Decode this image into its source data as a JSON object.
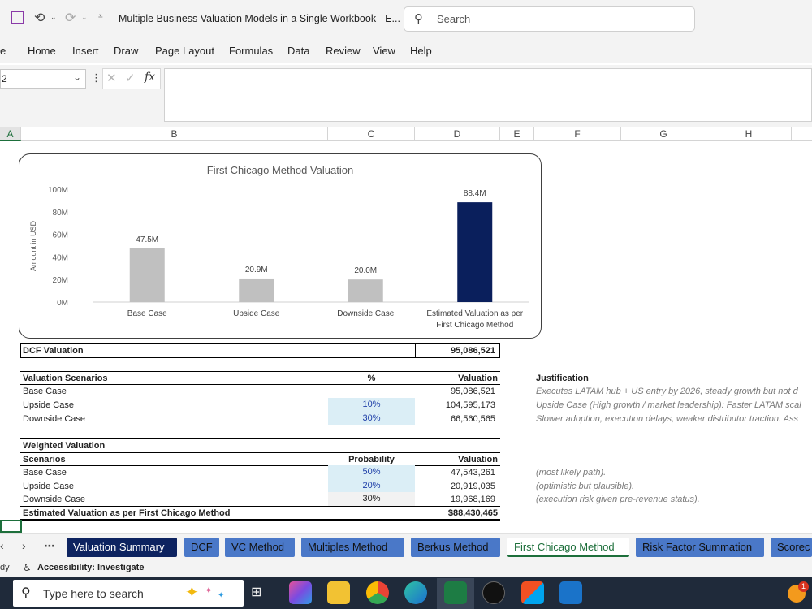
{
  "window": {
    "doc_title": "Multiple Business Valuation Models in a Single Workbook  -  E...",
    "search_placeholder": "Search"
  },
  "ribbon": {
    "tabs": [
      "e",
      "Home",
      "Insert",
      "Draw",
      "Page Layout",
      "Formulas",
      "Data",
      "Review",
      "View",
      "Help"
    ]
  },
  "formula_bar": {
    "name_box": "2",
    "fx": "fx"
  },
  "columns": [
    "A",
    "B",
    "C",
    "D",
    "E",
    "F",
    "G",
    "H"
  ],
  "chart_data": {
    "type": "bar",
    "title": "First Chicago Method Valuation",
    "ylabel": "Amount in USD",
    "xlabel": "",
    "categories": [
      "Base Case",
      "Upside Case",
      "Downside Case",
      "Estimated Valuation as per First Chicago Method"
    ],
    "category_lines": [
      [
        "Base Case"
      ],
      [
        "Upside Case"
      ],
      [
        "Downside Case"
      ],
      [
        "Estimated Valuation as per",
        "First Chicago Method"
      ]
    ],
    "values": [
      47.5,
      20.9,
      20.0,
      88.4
    ],
    "data_labels": [
      "47.5M",
      "20.9M",
      "20.0M",
      "88.4M"
    ],
    "unit": "M",
    "ylim": [
      0,
      100
    ],
    "yticks": [
      0,
      20,
      40,
      60,
      80,
      100
    ],
    "ytick_labels": [
      "0M",
      "20M",
      "40M",
      "60M",
      "80M",
      "100M"
    ],
    "bar_colors": [
      "#c0c0c0",
      "#c0c0c0",
      "#c0c0c0",
      "#0a1f5c"
    ],
    "grid": false,
    "legend": "none"
  },
  "dcf": {
    "label": "DCF Valuation",
    "value": "95,086,521"
  },
  "scenarios": {
    "header": {
      "name": "Valuation Scenarios",
      "pct": "%",
      "val": "Valuation",
      "just": "Justification"
    },
    "rows": [
      {
        "name": "Base Case",
        "pct": "",
        "val": "95,086,521",
        "just": "Executes LATAM hub + US entry by 2026, steady growth but not d"
      },
      {
        "name": "Upside Case",
        "pct": "10%",
        "val": "104,595,173",
        "just": "Upside Case (High growth / market leadership): Faster LATAM scal"
      },
      {
        "name": "Downside Case",
        "pct": "30%",
        "val": "66,560,565",
        "just": "Slower adoption, execution delays, weaker distributor traction. Ass"
      }
    ]
  },
  "weighted": {
    "title": "Weighted Valuation",
    "header": {
      "name": "Scenarios",
      "prob": "Probability",
      "val": "Valuation"
    },
    "rows": [
      {
        "name": "Base Case",
        "prob": "50%",
        "val": "47,543,261",
        "note": "(most likely path)."
      },
      {
        "name": "Upside Case",
        "prob": "20%",
        "val": "20,919,035",
        "note": "(optimistic but plausible)."
      },
      {
        "name": "Downside Case",
        "prob": "30%",
        "val": "19,968,169",
        "note": "(execution risk given pre-revenue status)."
      }
    ],
    "total": {
      "name": "Estimated Valuation as per First Chicago Method",
      "val": "$88,430,465"
    }
  },
  "sheet_tabs": [
    {
      "label": "Valuation Summary",
      "active": false
    },
    {
      "label": "DCF",
      "active": false
    },
    {
      "label": "VC Method",
      "active": false
    },
    {
      "label": "Multiples Method",
      "active": false
    },
    {
      "label": "Berkus Method",
      "active": false
    },
    {
      "label": "First Chicago Method",
      "active": true
    },
    {
      "label": "Risk Factor Summation",
      "active": false
    },
    {
      "label": "Scorec",
      "active": false
    }
  ],
  "status": {
    "ready": "dy",
    "accessibility": "Accessibility: Investigate"
  },
  "taskbar": {
    "search_placeholder": "Type here to search",
    "notification_count": "1"
  }
}
